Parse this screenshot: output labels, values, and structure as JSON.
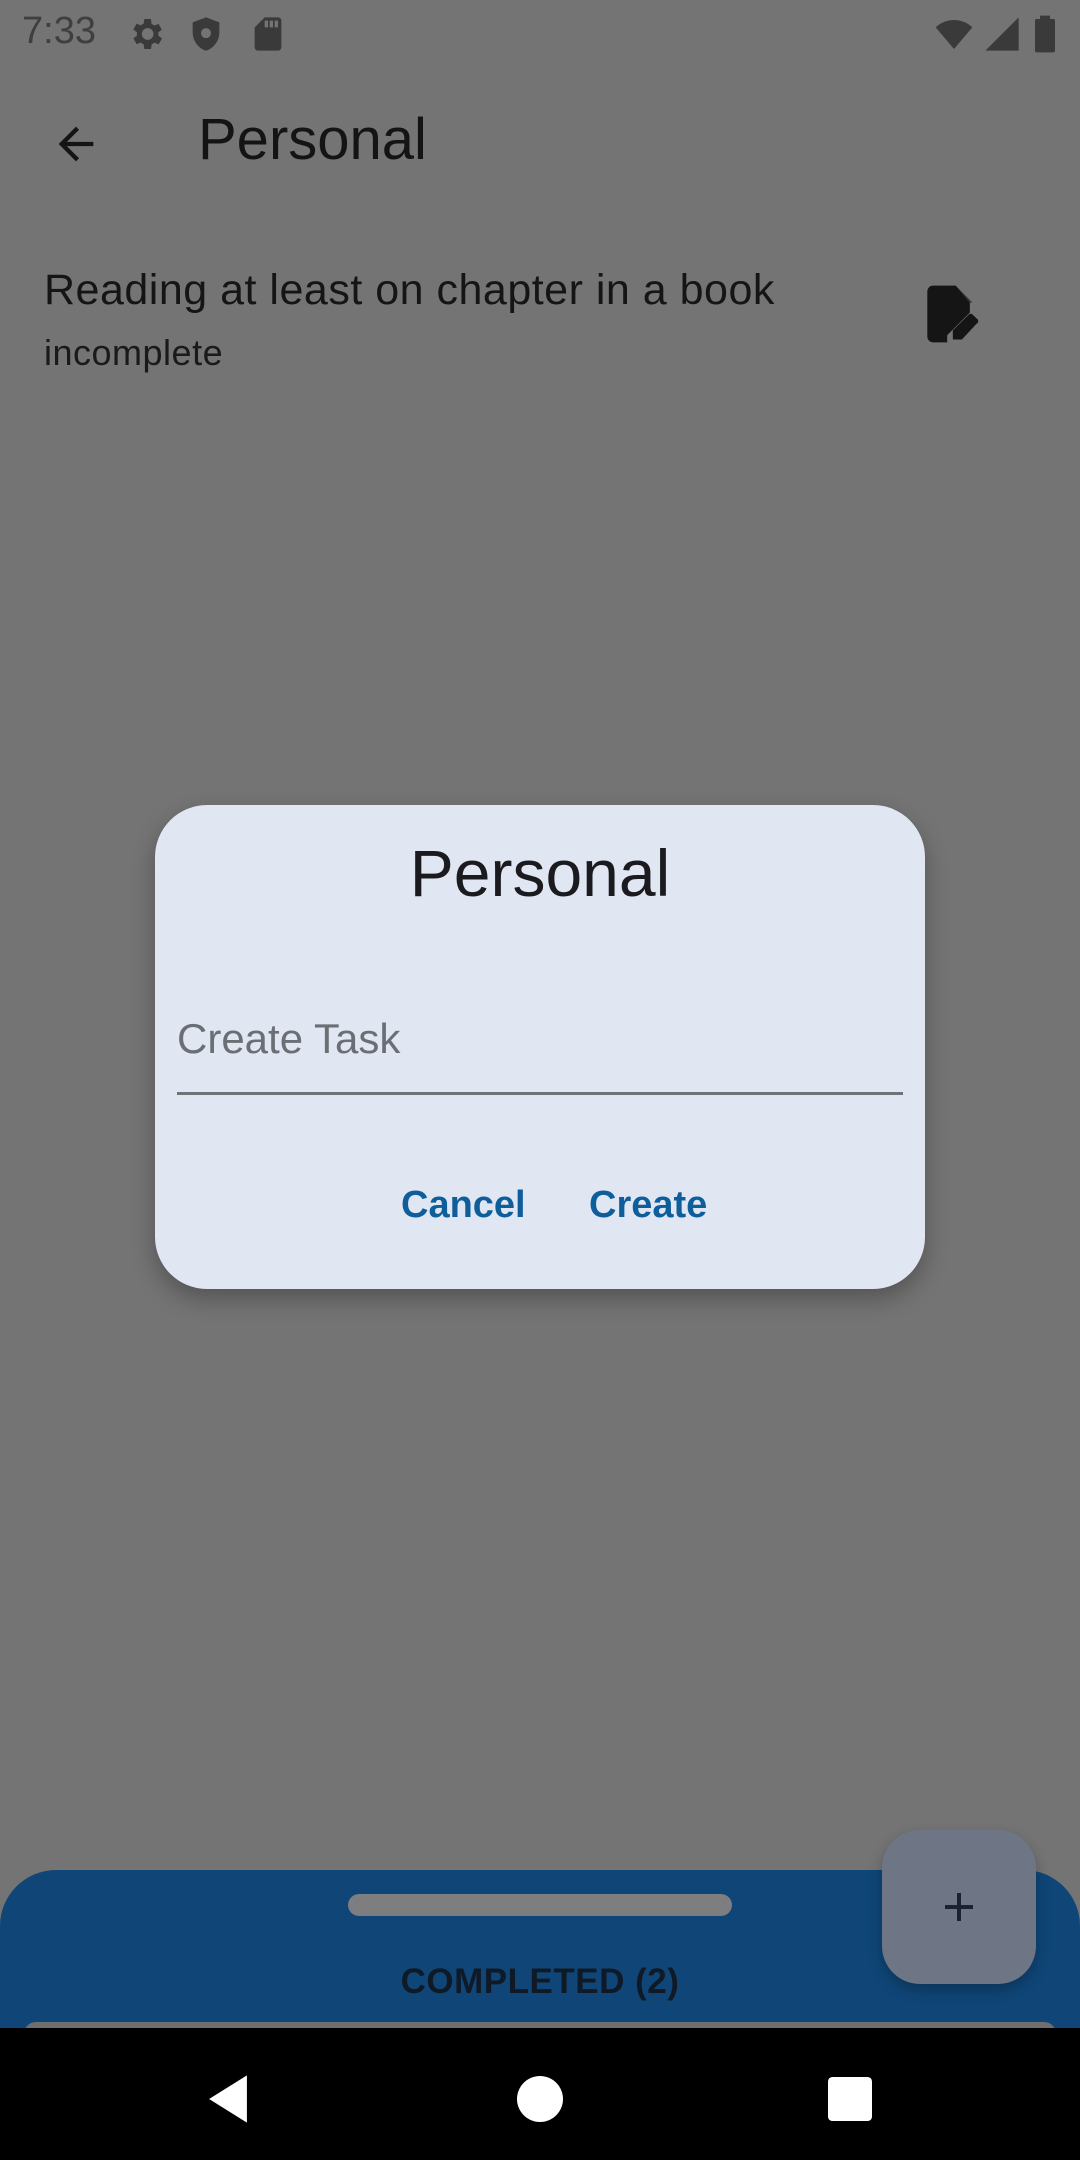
{
  "status_bar": {
    "time": "7:33",
    "icons": [
      "settings-icon",
      "shield-icon",
      "sd-card-icon",
      "wifi-icon",
      "signal-icon",
      "battery-icon"
    ]
  },
  "app_bar": {
    "title": "Personal",
    "back_icon": "arrow-back-icon"
  },
  "task": {
    "title": "Reading at least on chapter in a book",
    "status": "incomplete",
    "edit_icon": "edit-note-icon"
  },
  "dialog": {
    "title": "Personal",
    "input_placeholder": "Create Task",
    "input_value": "",
    "cancel_label": "Cancel",
    "create_label": "Create"
  },
  "bottom_sheet": {
    "label": "COMPLETED (2)"
  },
  "fab": {
    "icon": "plus-icon"
  },
  "nav_bar": {
    "icons": [
      "nav-back-icon",
      "nav-home-icon",
      "nav-recents-icon"
    ]
  },
  "colors": {
    "scrim_background": "#747474",
    "dialog_background": "#e0e7f2",
    "accent": "#0f5e9c",
    "sheet": "#0f4677"
  }
}
